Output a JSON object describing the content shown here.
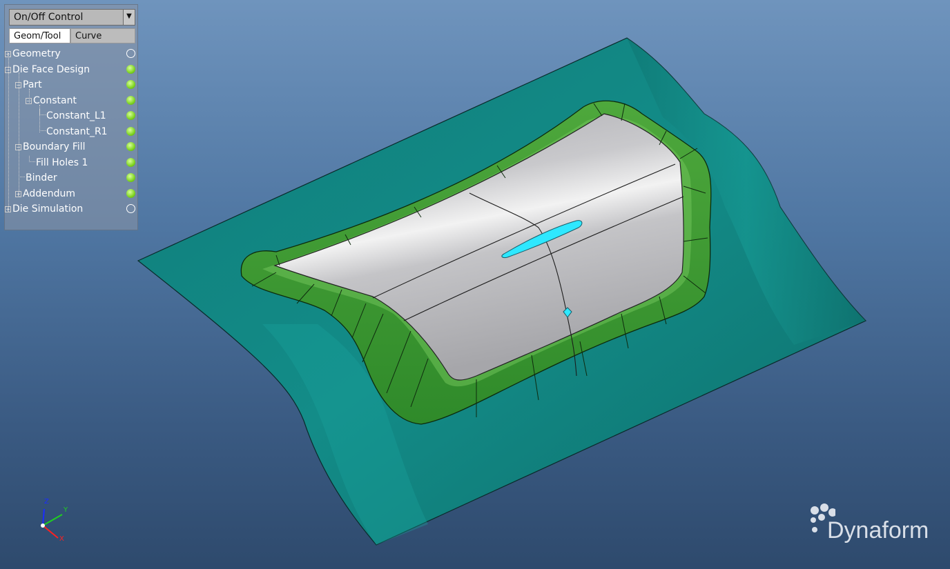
{
  "panel": {
    "dropdown_label": "On/Off Control",
    "tabs": [
      {
        "label": "Geom/Tool",
        "active": true
      },
      {
        "label": "Curve",
        "active": false
      }
    ],
    "tree": [
      {
        "label": "Geometry",
        "status": "off"
      },
      {
        "label": "Die Face Design",
        "status": "on"
      },
      {
        "label": "Part",
        "status": "on"
      },
      {
        "label": "Constant",
        "status": "on"
      },
      {
        "label": "Constant_L1",
        "status": "on"
      },
      {
        "label": "Constant_R1",
        "status": "on"
      },
      {
        "label": "Boundary Fill",
        "status": "on"
      },
      {
        "label": "Fill Holes 1",
        "status": "on"
      },
      {
        "label": "Binder",
        "status": "on"
      },
      {
        "label": "Addendum",
        "status": "on"
      },
      {
        "label": "Die Simulation",
        "status": "off"
      }
    ]
  },
  "triad": {
    "x": "X",
    "y": "Y",
    "z": "Z"
  },
  "logo": {
    "text": "Dynaform"
  },
  "colors": {
    "binder": "#128a86",
    "addendum": "#3f9a34",
    "part": "#b8b8bb",
    "hole_fill": "#2ee8ff",
    "status_on": "#7ed321"
  }
}
